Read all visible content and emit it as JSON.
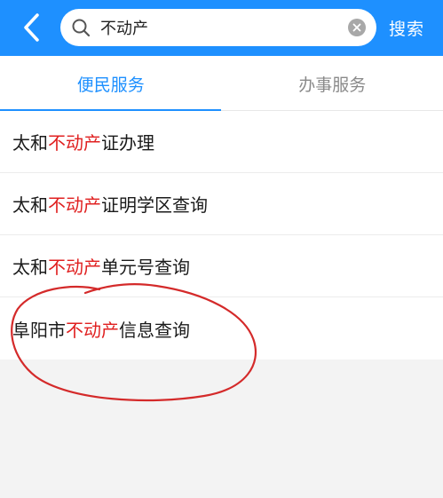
{
  "header": {
    "search": {
      "value": "不动产",
      "placeholder": ""
    },
    "search_button": "搜索",
    "colors": {
      "brand": "#1e90ff",
      "highlight": "#e02020",
      "annotation": "#d42a2a"
    }
  },
  "tabs": [
    {
      "label": "便民服务",
      "active": true
    },
    {
      "label": "办事服务",
      "active": false
    }
  ],
  "results": [
    {
      "prefix": "太和",
      "highlight": "不动产",
      "suffix": "证办理"
    },
    {
      "prefix": "太和",
      "highlight": "不动产",
      "suffix": "证明学区查询"
    },
    {
      "prefix": "太和",
      "highlight": "不动产",
      "suffix": "单元号查询"
    },
    {
      "prefix": "阜阳市",
      "highlight": "不动产",
      "suffix": "信息查询"
    }
  ],
  "icons": {
    "back": "chevron-left-icon",
    "search": "magnifier-icon",
    "clear": "close-circle-icon"
  }
}
